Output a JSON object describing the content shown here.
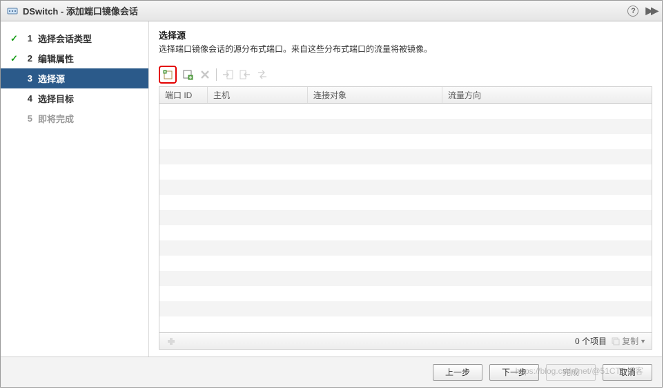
{
  "title": "DSwitch - 添加端口镜像会话",
  "steps": [
    {
      "num": "1",
      "label": "选择会话类型",
      "state": "completed"
    },
    {
      "num": "2",
      "label": "编辑属性",
      "state": "completed"
    },
    {
      "num": "3",
      "label": "选择源",
      "state": "active"
    },
    {
      "num": "4",
      "label": "选择目标",
      "state": "pending"
    },
    {
      "num": "5",
      "label": "即将完成",
      "state": "disabled"
    }
  ],
  "content": {
    "heading": "选择源",
    "description": "选择端口镜像会话的源分布式端口。来自这些分布式端口的流量将被镜像。"
  },
  "table": {
    "columns": [
      "端口 ID",
      "主机",
      "连接对象",
      "流量方向"
    ],
    "count_label": "0 个项目",
    "copy_label": "复制"
  },
  "footer": {
    "back": "上一步",
    "next": "下一步",
    "finish": "完成",
    "cancel": "取消"
  },
  "watermark": "https://blog.csdn.net/@51CTO博客"
}
